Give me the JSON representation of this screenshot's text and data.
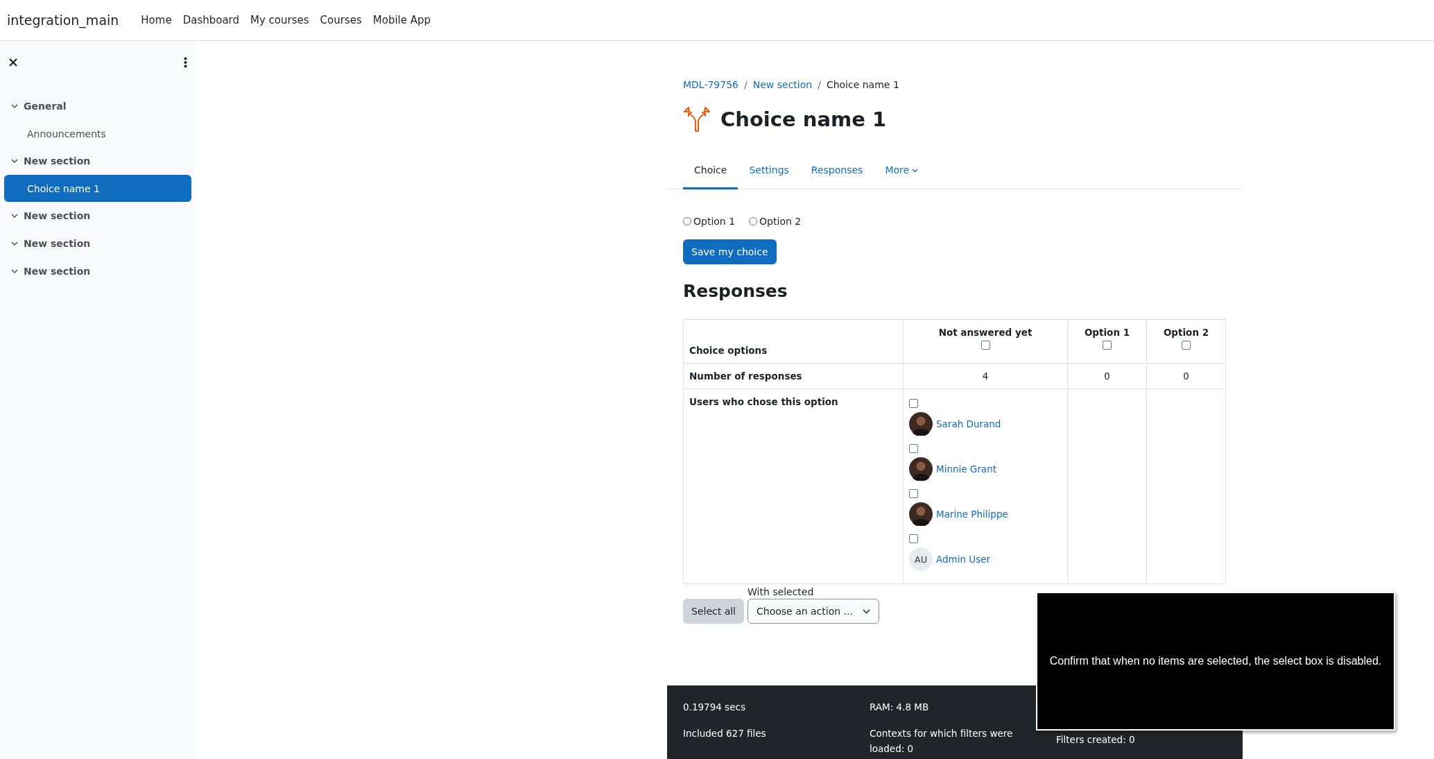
{
  "header": {
    "site_name": "integration_main",
    "nav": [
      "Home",
      "Dashboard",
      "My courses",
      "Courses",
      "Mobile App"
    ]
  },
  "sidebar": {
    "sections": [
      {
        "label": "General",
        "expanded": true,
        "children": [
          {
            "label": "Announcements",
            "selected": false
          }
        ]
      },
      {
        "label": "New section",
        "expanded": true,
        "children": [
          {
            "label": "Choice name 1",
            "selected": true
          }
        ]
      },
      {
        "label": "New section",
        "expanded": true
      },
      {
        "label": "New section",
        "expanded": true
      },
      {
        "label": "New section",
        "expanded": true
      }
    ]
  },
  "breadcrumb": [
    {
      "text": "MDL-79756",
      "kind": "link"
    },
    {
      "text": "/",
      "kind": "separator"
    },
    {
      "text": "New section",
      "kind": "link"
    },
    {
      "text": "/",
      "kind": "separator"
    },
    {
      "text": "Choice name 1",
      "kind": "current"
    }
  ],
  "title": "Choice name 1",
  "tabs": [
    {
      "label": "Choice",
      "selected": true,
      "kind": "link"
    },
    {
      "label": "Settings",
      "selected": false,
      "kind": "link"
    },
    {
      "label": "Responses",
      "selected": false,
      "kind": "link"
    },
    {
      "label": "More",
      "selected": false,
      "kind": "dropdown"
    }
  ],
  "options": [
    {
      "label": "Option 1",
      "selected": false
    },
    {
      "label": "Option 2",
      "selected": false
    }
  ],
  "save_button": "Save my choice",
  "responses_heading": "Responses",
  "table": {
    "corner": "Choice options",
    "columns": [
      {
        "label": "Not answered yet",
        "checked": false
      },
      {
        "label": "Option 1",
        "checked": false
      },
      {
        "label": "Option 2",
        "checked": false
      }
    ],
    "count_label": "Number of responses",
    "counts": [
      "4",
      "0",
      "0"
    ],
    "users_label": "Users who chose this option",
    "users": [
      {
        "name": "Sarah Durand",
        "checked": false,
        "kind": "photo"
      },
      {
        "name": "Minnie Grant",
        "checked": false,
        "kind": "photo"
      },
      {
        "name": "Marine Philippe",
        "checked": false,
        "kind": "photo"
      },
      {
        "name": "Admin User",
        "checked": false,
        "kind": "initials",
        "initials": "AU"
      }
    ]
  },
  "bulk": {
    "select_all": "Select all",
    "with_selected": "With selected",
    "action_placeholder": "Choose an action ..."
  },
  "footer": [
    [
      "0.19794 secs",
      "RAM: 4.8 MB"
    ],
    [
      "Included 627 files",
      "Contexts for which filters were loaded: 0",
      "Filters created: 0"
    ]
  ],
  "overlay": {
    "message": "Confirm that when no items are selected, the select box is disabled."
  }
}
